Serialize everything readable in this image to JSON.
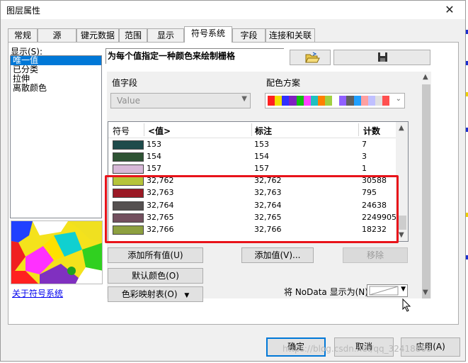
{
  "window": {
    "title": "图层属性"
  },
  "tabs": [
    {
      "label": "常规"
    },
    {
      "label": "源"
    },
    {
      "label": "键元数据"
    },
    {
      "label": "范围"
    },
    {
      "label": "显示"
    },
    {
      "label": "符号系统"
    },
    {
      "label": "字段"
    },
    {
      "label": "连接和关联"
    }
  ],
  "left": {
    "show_label": "显示(S):",
    "items": [
      "唯一值",
      "已分类",
      "拉伸",
      "离散颜色"
    ],
    "about_link": "关于符号系统"
  },
  "header": {
    "description": "为每个值指定一种颜色来绘制栅格"
  },
  "value_field": {
    "label": "值字段",
    "value": "Value"
  },
  "color_scheme": {
    "label": "配色方案",
    "colors": [
      "#ff2020",
      "#f0e000",
      "#3030ff",
      "#8020c0",
      "#10c010",
      "#ff40ff",
      "#20c0c0",
      "#ff8000",
      "#a0d040",
      "#ffffff",
      "#9060ff",
      "#606060",
      "#20a0ff",
      "#ffa0a0",
      "#c0c0ff",
      "#e0e0e0",
      "#ff5050"
    ]
  },
  "table": {
    "headers": [
      "符号",
      "<值>",
      "标注",
      "计数"
    ],
    "rows": [
      {
        "color": "#1e4b4b",
        "value": "153",
        "label": "153",
        "count": "7"
      },
      {
        "color": "#2e5334",
        "value": "154",
        "label": "154",
        "count": "3"
      },
      {
        "color": "#d8b8d8",
        "value": "157",
        "label": "157",
        "count": "1"
      },
      {
        "color": "#b5c43a",
        "value": "32,762",
        "label": "32,762",
        "count": "30588"
      },
      {
        "color": "#9b1925",
        "value": "32,763",
        "label": "32,763",
        "count": "795"
      },
      {
        "color": "#555050",
        "value": "32,764",
        "label": "32,764",
        "count": "24638"
      },
      {
        "color": "#73505f",
        "value": "32,765",
        "label": "32,765",
        "count": "2249905"
      },
      {
        "color": "#8da040",
        "value": "32,766",
        "label": "32,766",
        "count": "18232"
      }
    ]
  },
  "buttons": {
    "add_all": "添加所有值(U)",
    "add_value": "添加值(V)...",
    "remove": "移除",
    "default_colors": "默认颜色(O)",
    "colormap": "色彩映射表(O)"
  },
  "nodata": {
    "label": "将 NoData 显示为(N)"
  },
  "footer": {
    "ok": "确定",
    "cancel": "取消",
    "apply": "应用(A)"
  },
  "watermark": "https://blog.csdn.net/qq_32418868"
}
